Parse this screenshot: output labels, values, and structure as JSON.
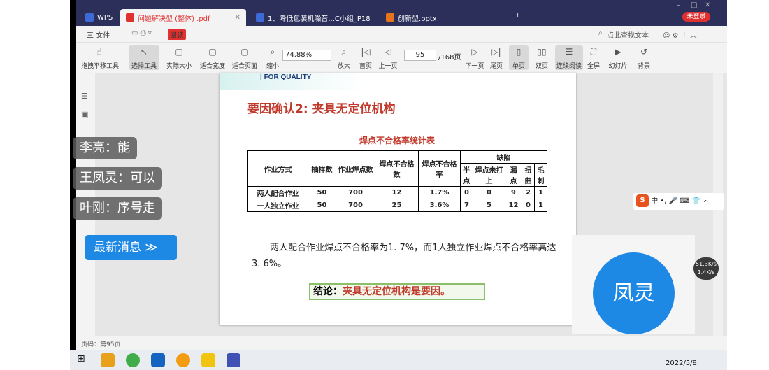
{
  "tabs": [
    {
      "label": "WPS",
      "icon": "wps-logo-icon"
    },
    {
      "label": "问题解决型 (整体) .pdf",
      "icon": "pdf-icon"
    },
    {
      "label": "1、降低包装机噪音...C小组_P18",
      "icon": "word-icon"
    },
    {
      "label": "创新型.pptx",
      "icon": "ppt-icon"
    }
  ],
  "login_label": "未登录",
  "menu": {
    "file_label": "三 文件",
    "read_label": "阅读",
    "search_label": "点此查找文本"
  },
  "toolbar": {
    "items": [
      "拖拽平移工具",
      "选择工具",
      "实际大小",
      "适合宽度",
      "适合页面",
      "缩小",
      "放大",
      "首页",
      "上一页",
      "下一页",
      "尾页",
      "单页",
      "双页",
      "连续阅读",
      "全屏",
      "幻灯片",
      "背景"
    ],
    "zoom_value": "74.88%",
    "page_value": "95",
    "page_total": "/168页"
  },
  "slide": {
    "banner": "| FOR QUALITY",
    "title": "要因确认2:   夹具无定位机构",
    "table_title": "焊点不合格率统计表",
    "headers": [
      "作业方式",
      "抽样数",
      "作业焊点数",
      "焊点不合格数",
      "焊点不合格率",
      "缺陷"
    ],
    "defect_headers": [
      "半点",
      "焊点未打上",
      "漏点",
      "扭曲",
      "毛刺"
    ],
    "rows": [
      [
        "两人配合作业",
        "50",
        "700",
        "12",
        "1.7%",
        "0",
        "0",
        "9",
        "2",
        "1"
      ],
      [
        "一人独立作业",
        "50",
        "700",
        "25",
        "3.6%",
        "7",
        "5",
        "12",
        "0",
        "1"
      ]
    ],
    "paragraph": "两人配合作业焊点不合格率为1. 7%，而1人独立作业焊点不合格率高达3. 6%。",
    "conclusion_label": "结论：",
    "conclusion_value": "夹具无定位机构是要因。"
  },
  "status": "页码：第95页",
  "chat": [
    {
      "text": "李亮：能"
    },
    {
      "text": "王凤灵：可以"
    },
    {
      "text": "叶刚：序号走"
    }
  ],
  "latest_button": "最新消息 ≫",
  "video": {
    "name": "凤灵"
  },
  "ime_label": "中 •, 🎤 ⌨ 👕 ⁙",
  "netspeed": {
    "up": "51.3K/s",
    "down": "1.4K/s"
  },
  "clock": "2022/5/8",
  "colors": {
    "accent_blue": "#1e88e5",
    "title_red": "#c0392b",
    "wps_dark": "#2b2f5a"
  }
}
